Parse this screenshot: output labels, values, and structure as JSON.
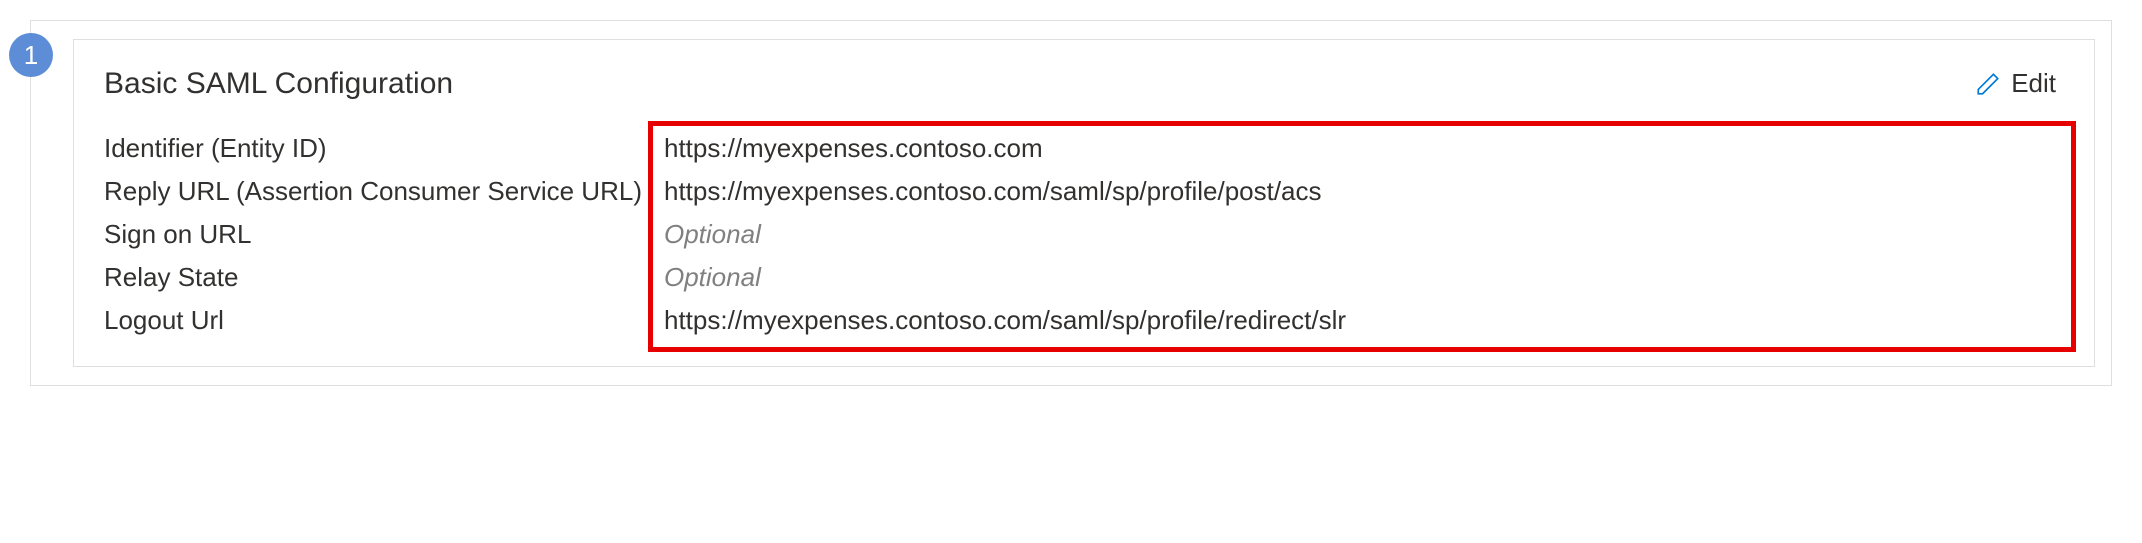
{
  "step": {
    "number": "1"
  },
  "card": {
    "title": "Basic SAML Configuration",
    "edit_label": "Edit"
  },
  "fields": [
    {
      "label": "Identifier (Entity ID)",
      "value": "https://myexpenses.contoso.com",
      "optional": false
    },
    {
      "label": "Reply URL (Assertion Consumer Service URL)",
      "value": "https://myexpenses.contoso.com/saml/sp/profile/post/acs",
      "optional": false
    },
    {
      "label": "Sign on URL",
      "value": "Optional",
      "optional": true
    },
    {
      "label": "Relay State",
      "value": "Optional",
      "optional": true
    },
    {
      "label": "Logout Url",
      "value": "https://myexpenses.contoso.com/saml/sp/profile/redirect/slr",
      "optional": false
    }
  ]
}
